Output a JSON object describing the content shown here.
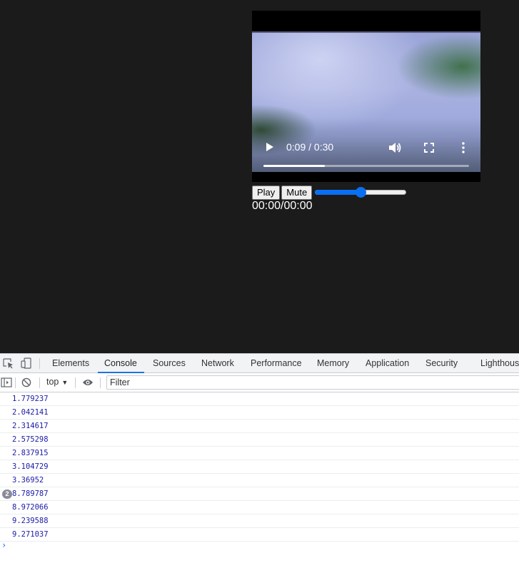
{
  "video": {
    "time_label": "0:09 / 0:30",
    "progress_fraction": 0.3,
    "icons": {
      "play": "play-icon",
      "volume": "volume-icon",
      "fullscreen": "fullscreen-icon",
      "more": "more-vert-icon"
    }
  },
  "custom_controls": {
    "play_label": "Play",
    "mute_label": "Mute",
    "volume_fraction": 0.5,
    "time_display": "00:00/00:00"
  },
  "devtools": {
    "tabs": [
      "Elements",
      "Console",
      "Sources",
      "Network",
      "Performance",
      "Memory",
      "Application",
      "Security",
      "Lighthouse"
    ],
    "active_tab": "Console",
    "toolbar": {
      "context": "top",
      "filter_placeholder": "Filter"
    },
    "console_logs": [
      {
        "value": "1.779237"
      },
      {
        "value": "2.042141"
      },
      {
        "value": "2.314617"
      },
      {
        "value": "2.575298"
      },
      {
        "value": "2.837915"
      },
      {
        "value": "3.104729"
      },
      {
        "value": "3.36952"
      },
      {
        "value": "8.789787",
        "repeat": "2"
      },
      {
        "value": "8.972066"
      },
      {
        "value": "9.239588"
      },
      {
        "value": "9.271037"
      }
    ],
    "prompt": "›"
  },
  "colors": {
    "page_bg": "#1b1b1b",
    "accent": "#1a73e8",
    "slider": "#0b6ff2",
    "log_number": "#1a1aa6"
  }
}
